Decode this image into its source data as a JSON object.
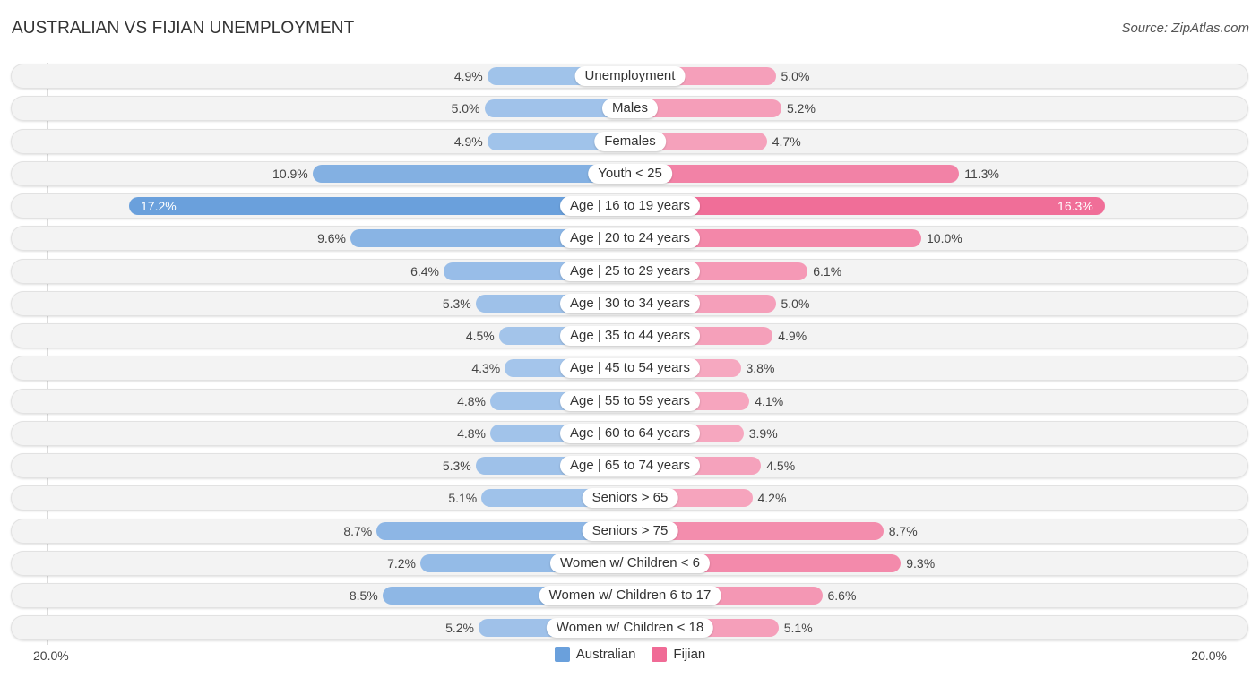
{
  "header": {
    "title": "AUSTRALIAN VS FIJIAN UNEMPLOYMENT",
    "source": "Source: ZipAtlas.com"
  },
  "colors": {
    "australian": "#6aa0dc",
    "australian_light": "#a9c8ec",
    "fijian": "#f06b96",
    "fijian_light": "#f6a8c0"
  },
  "chart_data": {
    "type": "bar",
    "orientation": "horizontal-diverging",
    "title": "AUSTRALIAN VS FIJIAN UNEMPLOYMENT",
    "xlim": [
      -20,
      20
    ],
    "axis_left_label": "20.0%",
    "axis_right_label": "20.0%",
    "legend": [
      "Australian",
      "Fijian"
    ],
    "legend_position": "bottom-center",
    "categories": [
      "Unemployment",
      "Males",
      "Females",
      "Youth < 25",
      "Age | 16 to 19 years",
      "Age | 20 to 24 years",
      "Age | 25 to 29 years",
      "Age | 30 to 34 years",
      "Age | 35 to 44 years",
      "Age | 45 to 54 years",
      "Age | 55 to 59 years",
      "Age | 60 to 64 years",
      "Age | 65 to 74 years",
      "Seniors > 65",
      "Seniors > 75",
      "Women w/ Children < 6",
      "Women w/ Children 6 to 17",
      "Women w/ Children < 18"
    ],
    "series": [
      {
        "name": "Australian",
        "values": [
          4.9,
          5.0,
          4.9,
          10.9,
          17.2,
          9.6,
          6.4,
          5.3,
          4.5,
          4.3,
          4.8,
          4.8,
          5.3,
          5.1,
          8.7,
          7.2,
          8.5,
          5.2
        ],
        "labels": [
          "4.9%",
          "5.0%",
          "4.9%",
          "10.9%",
          "17.2%",
          "9.6%",
          "6.4%",
          "5.3%",
          "4.5%",
          "4.3%",
          "4.8%",
          "4.8%",
          "5.3%",
          "5.1%",
          "8.7%",
          "7.2%",
          "8.5%",
          "5.2%"
        ]
      },
      {
        "name": "Fijian",
        "values": [
          5.0,
          5.2,
          4.7,
          11.3,
          16.3,
          10.0,
          6.1,
          5.0,
          4.9,
          3.8,
          4.1,
          3.9,
          4.5,
          4.2,
          8.7,
          9.3,
          6.6,
          5.1
        ],
        "labels": [
          "5.0%",
          "5.2%",
          "4.7%",
          "11.3%",
          "16.3%",
          "10.0%",
          "6.1%",
          "5.0%",
          "4.9%",
          "3.8%",
          "4.1%",
          "3.9%",
          "4.5%",
          "4.2%",
          "8.7%",
          "9.3%",
          "6.6%",
          "5.1%"
        ]
      }
    ]
  }
}
